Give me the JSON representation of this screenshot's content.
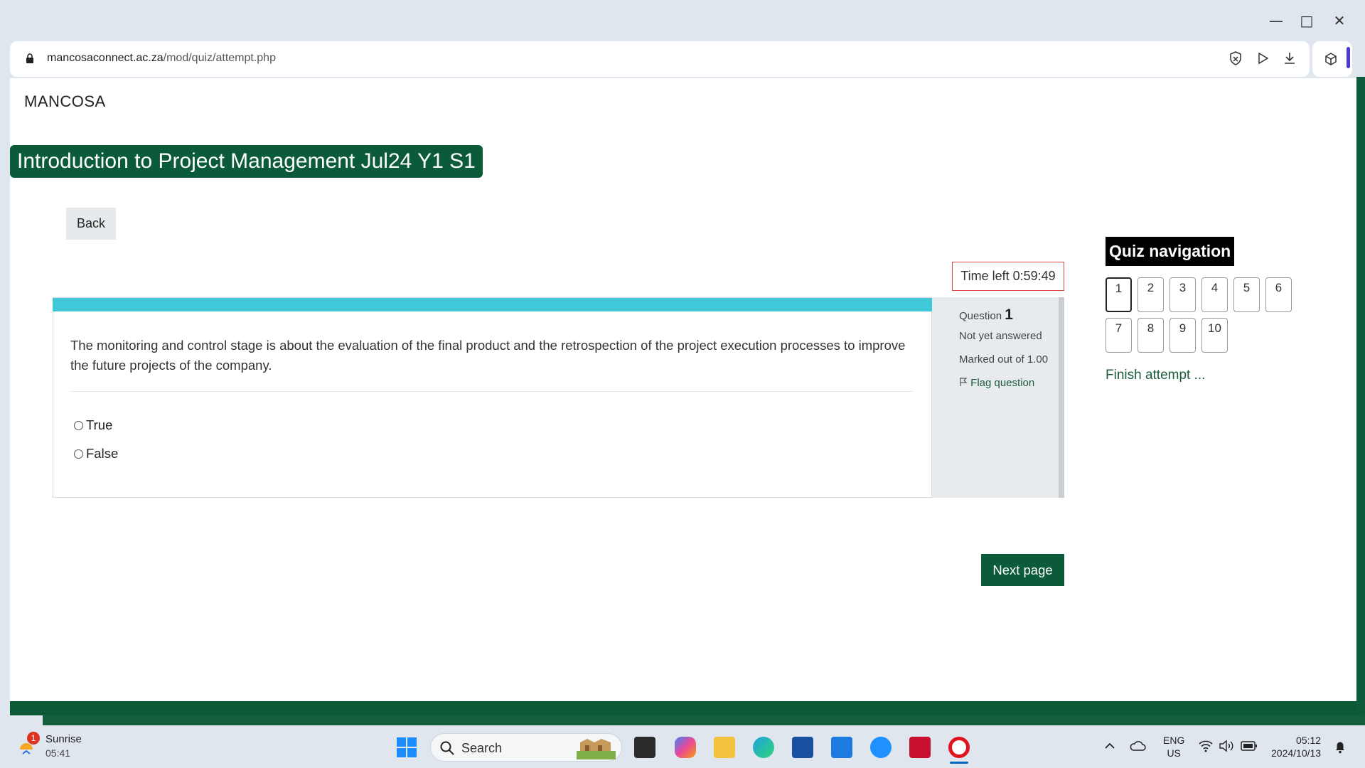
{
  "browser": {
    "url_host": "mancosaconnect.ac.za",
    "url_path": "/mod/quiz/attempt.php",
    "window_controls": [
      "minimize-icon",
      "maximize-icon",
      "close-icon"
    ],
    "toolbar_icons": [
      "shield-icon",
      "play-icon",
      "download-icon",
      "extensions-icon"
    ]
  },
  "page": {
    "brand": "MANCOSA",
    "course_title": "Introduction to Project Management Jul24 Y1 S1",
    "back_label": "Back",
    "timer": "Time left 0:59:49",
    "question": {
      "label": "Question",
      "number": "1",
      "status": "Not yet answered",
      "marks": "Marked out of 1.00",
      "flag_label": "Flag question",
      "text": "The monitoring and control stage is about the evaluation of the final product and the retrospection of the project execution processes to improve the future projects of the company.",
      "options": [
        "True",
        "False"
      ]
    },
    "next_label": "Next page",
    "nav": {
      "title": "Quiz navigation",
      "questions": [
        "1",
        "2",
        "3",
        "4",
        "5",
        "6",
        "7",
        "8",
        "9",
        "10"
      ],
      "current": "1",
      "finish_label": "Finish attempt ..."
    }
  },
  "colors": {
    "brand_green": "#0b5a39",
    "question_bar": "#3ec8d8",
    "timer_border": "#dd4444"
  },
  "taskbar": {
    "weather_badge": "1",
    "weather_name": "Sunrise",
    "weather_time": "05:41",
    "search_placeholder": "Search",
    "pinned_icons": [
      "file-explorer-dark-icon",
      "copilot-icon",
      "folder-icon",
      "edge-icon",
      "store-icon",
      "myhp-icon",
      "help-icon",
      "mcafee-icon",
      "opera-icon"
    ],
    "lang_line1": "ENG",
    "lang_line2": "US",
    "time": "05:12",
    "date": "2024/10/13"
  }
}
